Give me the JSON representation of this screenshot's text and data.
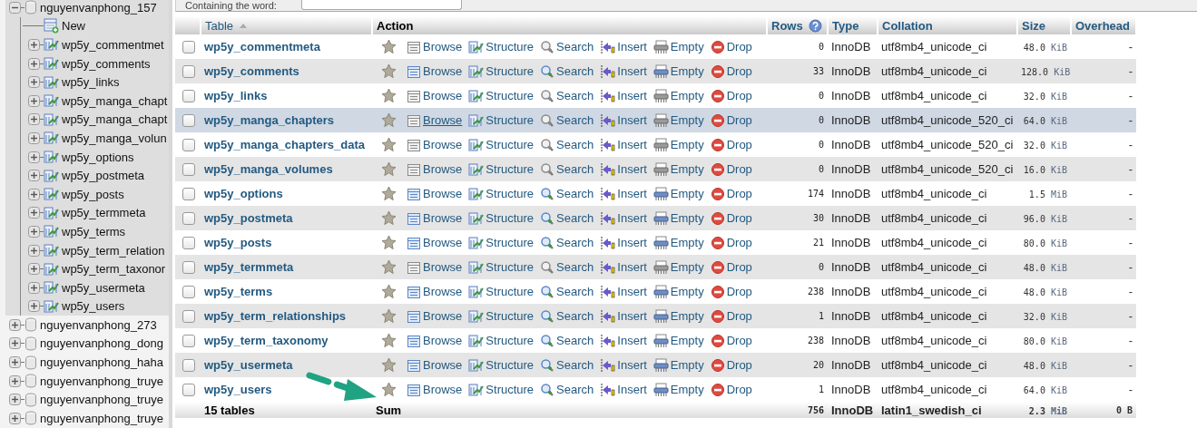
{
  "navigation": [
    {
      "kind": "database",
      "name": "nguyenvanphong_157",
      "expanded": true,
      "children": [
        {
          "kind": "new",
          "name": "New"
        },
        {
          "kind": "table",
          "name": "wp5y_commentmet",
          "expanded": false
        },
        {
          "kind": "table",
          "name": "wp5y_comments",
          "expanded": false
        },
        {
          "kind": "table",
          "name": "wp5y_links",
          "expanded": false
        },
        {
          "kind": "table",
          "name": "wp5y_manga_chapt",
          "expanded": false
        },
        {
          "kind": "table",
          "name": "wp5y_manga_chapt",
          "expanded": false
        },
        {
          "kind": "table",
          "name": "wp5y_manga_volun",
          "expanded": false
        },
        {
          "kind": "table",
          "name": "wp5y_options",
          "expanded": false
        },
        {
          "kind": "table",
          "name": "wp5y_postmeta",
          "expanded": false
        },
        {
          "kind": "table",
          "name": "wp5y_posts",
          "expanded": false
        },
        {
          "kind": "table",
          "name": "wp5y_termmeta",
          "expanded": false
        },
        {
          "kind": "table",
          "name": "wp5y_terms",
          "expanded": false
        },
        {
          "kind": "table",
          "name": "wp5y_term_relation",
          "expanded": false
        },
        {
          "kind": "table",
          "name": "wp5y_term_taxonor",
          "expanded": false
        },
        {
          "kind": "table",
          "name": "wp5y_usermeta",
          "expanded": false
        },
        {
          "kind": "table",
          "name": "wp5y_users",
          "expanded": false
        }
      ]
    },
    {
      "kind": "database",
      "name": "nguyenvanphong_273",
      "expanded": false
    },
    {
      "kind": "database",
      "name": "nguyenvanphong_dong",
      "expanded": false
    },
    {
      "kind": "database",
      "name": "nguyenvanphong_haha",
      "expanded": false
    },
    {
      "kind": "database",
      "name": "nguyenvanphong_truye",
      "expanded": false
    },
    {
      "kind": "database",
      "name": "nguyenvanphong_truye",
      "expanded": false
    },
    {
      "kind": "database",
      "name": "nguyenvanphong_truye",
      "expanded": false
    }
  ],
  "filter": {
    "label": "Containing the word:"
  },
  "table": {
    "columns": [
      "Table",
      "Action",
      "Rows",
      "Type",
      "Collation",
      "Size",
      "Overhead"
    ],
    "rows": [
      {
        "name": "wp5y_commentmeta",
        "empty": true,
        "hover": false,
        "checked": false,
        "actions": [
          "Browse",
          "Structure",
          "Search",
          "Insert",
          "Empty",
          "Drop"
        ],
        "rows": "0",
        "type": "InnoDB",
        "collation": "utf8mb4_unicode_ci",
        "size": "48.0",
        "unit": "KiB",
        "overhead": "-"
      },
      {
        "name": "wp5y_comments",
        "empty": false,
        "hover": false,
        "checked": false,
        "actions": [
          "Browse",
          "Structure",
          "Search",
          "Insert",
          "Empty",
          "Drop"
        ],
        "rows": "33",
        "type": "InnoDB",
        "collation": "utf8mb4_unicode_ci",
        "size": "128.0",
        "unit": "KiB",
        "overhead": "-"
      },
      {
        "name": "wp5y_links",
        "empty": true,
        "hover": false,
        "checked": false,
        "actions": [
          "Browse",
          "Structure",
          "Search",
          "Insert",
          "Empty",
          "Drop"
        ],
        "rows": "0",
        "type": "InnoDB",
        "collation": "utf8mb4_unicode_ci",
        "size": "32.0",
        "unit": "KiB",
        "overhead": "-"
      },
      {
        "name": "wp5y_manga_chapters",
        "empty": true,
        "hover": true,
        "checked": false,
        "actions": [
          "Browse",
          "Structure",
          "Search",
          "Insert",
          "Empty",
          "Drop"
        ],
        "rows": "0",
        "type": "InnoDB",
        "collation": "utf8mb4_unicode_520_ci",
        "size": "64.0",
        "unit": "KiB",
        "overhead": "-"
      },
      {
        "name": "wp5y_manga_chapters_data",
        "empty": true,
        "hover": false,
        "checked": false,
        "actions": [
          "Browse",
          "Structure",
          "Search",
          "Insert",
          "Empty",
          "Drop"
        ],
        "rows": "0",
        "type": "InnoDB",
        "collation": "utf8mb4_unicode_520_ci",
        "size": "32.0",
        "unit": "KiB",
        "overhead": "-"
      },
      {
        "name": "wp5y_manga_volumes",
        "empty": true,
        "hover": false,
        "checked": false,
        "actions": [
          "Browse",
          "Structure",
          "Search",
          "Insert",
          "Empty",
          "Drop"
        ],
        "rows": "0",
        "type": "InnoDB",
        "collation": "utf8mb4_unicode_520_ci",
        "size": "16.0",
        "unit": "KiB",
        "overhead": "-"
      },
      {
        "name": "wp5y_options",
        "empty": false,
        "hover": false,
        "checked": false,
        "actions": [
          "Browse",
          "Structure",
          "Search",
          "Insert",
          "Empty",
          "Drop"
        ],
        "rows": "174",
        "type": "InnoDB",
        "collation": "utf8mb4_unicode_ci",
        "size": "1.5",
        "unit": "MiB",
        "overhead": "-"
      },
      {
        "name": "wp5y_postmeta",
        "empty": false,
        "hover": false,
        "checked": false,
        "actions": [
          "Browse",
          "Structure",
          "Search",
          "Insert",
          "Empty",
          "Drop"
        ],
        "rows": "30",
        "type": "InnoDB",
        "collation": "utf8mb4_unicode_ci",
        "size": "96.0",
        "unit": "KiB",
        "overhead": "-"
      },
      {
        "name": "wp5y_posts",
        "empty": false,
        "hover": false,
        "checked": false,
        "actions": [
          "Browse",
          "Structure",
          "Search",
          "Insert",
          "Empty",
          "Drop"
        ],
        "rows": "21",
        "type": "InnoDB",
        "collation": "utf8mb4_unicode_ci",
        "size": "80.0",
        "unit": "KiB",
        "overhead": "-"
      },
      {
        "name": "wp5y_termmeta",
        "empty": true,
        "hover": false,
        "checked": false,
        "actions": [
          "Browse",
          "Structure",
          "Search",
          "Insert",
          "Empty",
          "Drop"
        ],
        "rows": "0",
        "type": "InnoDB",
        "collation": "utf8mb4_unicode_ci",
        "size": "48.0",
        "unit": "KiB",
        "overhead": "-"
      },
      {
        "name": "wp5y_terms",
        "empty": false,
        "hover": false,
        "checked": false,
        "actions": [
          "Browse",
          "Structure",
          "Search",
          "Insert",
          "Empty",
          "Drop"
        ],
        "rows": "238",
        "type": "InnoDB",
        "collation": "utf8mb4_unicode_ci",
        "size": "48.0",
        "unit": "KiB",
        "overhead": "-"
      },
      {
        "name": "wp5y_term_relationships",
        "empty": false,
        "hover": false,
        "checked": false,
        "actions": [
          "Browse",
          "Structure",
          "Search",
          "Insert",
          "Empty",
          "Drop"
        ],
        "rows": "1",
        "type": "InnoDB",
        "collation": "utf8mb4_unicode_ci",
        "size": "32.0",
        "unit": "KiB",
        "overhead": "-"
      },
      {
        "name": "wp5y_term_taxonomy",
        "empty": false,
        "hover": false,
        "checked": false,
        "actions": [
          "Browse",
          "Structure",
          "Search",
          "Insert",
          "Empty",
          "Drop"
        ],
        "rows": "238",
        "type": "InnoDB",
        "collation": "utf8mb4_unicode_ci",
        "size": "80.0",
        "unit": "KiB",
        "overhead": "-"
      },
      {
        "name": "wp5y_usermeta",
        "empty": false,
        "hover": false,
        "checked": false,
        "actions": [
          "Browse",
          "Structure",
          "Search",
          "Insert",
          "Empty",
          "Drop"
        ],
        "rows": "20",
        "type": "InnoDB",
        "collation": "utf8mb4_unicode_ci",
        "size": "48.0",
        "unit": "KiB",
        "overhead": "-"
      },
      {
        "name": "wp5y_users",
        "empty": false,
        "hover": false,
        "checked": false,
        "actions": [
          "Browse",
          "Structure",
          "Search",
          "Insert",
          "Empty",
          "Drop"
        ],
        "rows": "1",
        "type": "InnoDB",
        "collation": "utf8mb4_unicode_ci",
        "size": "64.0",
        "unit": "KiB",
        "overhead": "-"
      }
    ],
    "footer": {
      "count": "15 tables",
      "label": "Sum",
      "rows": "756",
      "type": "InnoDB",
      "collation": "latin1_swedish_ci",
      "size": "2.3",
      "unit": "MiB",
      "overhead": "0 B"
    }
  },
  "annotation_arrow": true
}
